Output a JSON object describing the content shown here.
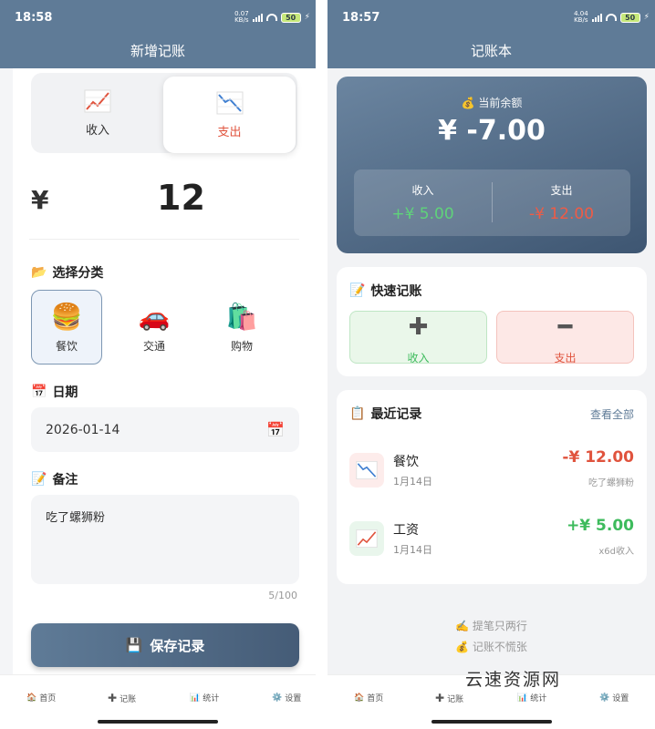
{
  "left": {
    "status": {
      "time": "18:58",
      "speed": "0.07\nKB/s",
      "battery": "50"
    },
    "title": "新增记账",
    "type_toggle": [
      {
        "label": "收入",
        "icon": "chart-up-icon"
      },
      {
        "label": "支出",
        "icon": "chart-down-icon",
        "active": true
      }
    ],
    "currency": "¥",
    "amount": "12",
    "category_label": "选择分类",
    "categories": [
      {
        "label": "餐饮",
        "emoji": "🍔",
        "selected": true
      },
      {
        "label": "交通",
        "emoji": "🚗"
      },
      {
        "label": "购物",
        "emoji": "🛍️"
      }
    ],
    "date_label": "日期",
    "date_value": "2026-01-14",
    "note_label": "备注",
    "note_value": "吃了螺狮粉",
    "note_counter": "5/100",
    "save_label": "保存记录"
  },
  "right": {
    "status": {
      "time": "18:57",
      "speed": "4.04\nKB/s",
      "battery": "50"
    },
    "title": "记账本",
    "balance_label": "当前余额",
    "balance_amount": "¥ -7.00",
    "income_label": "收入",
    "income_value": "+¥ 5.00",
    "expense_label": "支出",
    "expense_value": "-¥ 12.00",
    "quick_title": "快速记账",
    "quick_income": "收入",
    "quick_expense": "支出",
    "recent_title": "最近记录",
    "view_all": "查看全部",
    "records": [
      {
        "name": "餐饮",
        "date": "1月14日",
        "amount": "-¥ 12.00",
        "note": "吃了螺狮粉",
        "kind": "expense"
      },
      {
        "name": "工资",
        "date": "1月14日",
        "amount": "+¥ 5.00",
        "note": "x6d收入",
        "kind": "income"
      }
    ],
    "footer": [
      "提笔只两行",
      "记账不慌张"
    ]
  },
  "tabs": [
    {
      "label": "首页",
      "icon": "home-icon"
    },
    {
      "label": "记账",
      "icon": "plus-icon"
    },
    {
      "label": "统计",
      "icon": "bar-chart-icon"
    },
    {
      "label": "设置",
      "icon": "gear-icon"
    }
  ],
  "watermark": "云速资源网",
  "colors": {
    "primary": "#5f7b97",
    "income": "#3dbb5c",
    "expense": "#e0533d"
  }
}
